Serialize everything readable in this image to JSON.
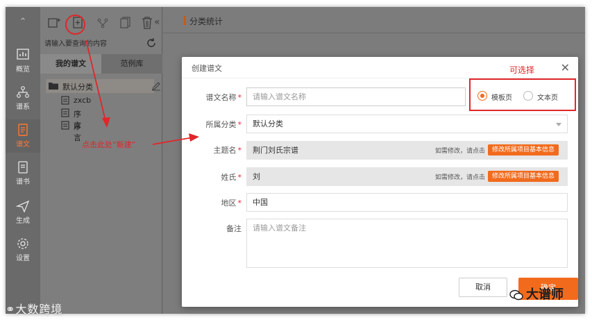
{
  "rail": {
    "items": [
      {
        "label": "概览",
        "icon": "chart-icon"
      },
      {
        "label": "谱系",
        "icon": "tree-icon"
      },
      {
        "label": "谱文",
        "icon": "document-icon"
      },
      {
        "label": "谱书",
        "icon": "book-icon"
      },
      {
        "label": "生成",
        "icon": "send-icon"
      },
      {
        "label": "设置",
        "icon": "gear-icon"
      }
    ],
    "active": "谱文"
  },
  "tree": {
    "search_placeholder": "请输入要查询的内容",
    "tabs": [
      "我的谱文",
      "范例库"
    ],
    "root_label": "默认分类",
    "items": [
      "zxcb",
      "序言",
      "序言"
    ]
  },
  "main": {
    "header_title": "分类统计"
  },
  "modal": {
    "title": "创建谱文",
    "fields": {
      "name": {
        "label": "谱文名称",
        "placeholder": "请输入谱文名称"
      },
      "category": {
        "label": "所属分类",
        "value": "默认分类"
      },
      "subject": {
        "label": "主题名",
        "value": "荆门刘氏宗谱",
        "hint": "如需修改，请点击",
        "button": "修改所属项目基本信息"
      },
      "surname": {
        "label": "姓氏",
        "value": "刘",
        "hint": "如需修改，请点击",
        "button": "修改所属项目基本信息"
      },
      "region": {
        "label": "地区",
        "value": "中国"
      },
      "note": {
        "label": "备注",
        "placeholder": "请输入谱文备注"
      }
    },
    "radio_options": [
      "模板页",
      "文本页"
    ],
    "radio_selected": "模板页",
    "cancel_label": "取消",
    "ok_label": "确定"
  },
  "annotations": {
    "selectable": "可选择",
    "click_new": "点击此处“新建”"
  },
  "watermarks": {
    "left": "大数跨境",
    "right": "大谱师"
  },
  "colors": {
    "accent": "#f26b1d",
    "annotation": "#e0262a",
    "overlay": "#7b7b7b"
  }
}
